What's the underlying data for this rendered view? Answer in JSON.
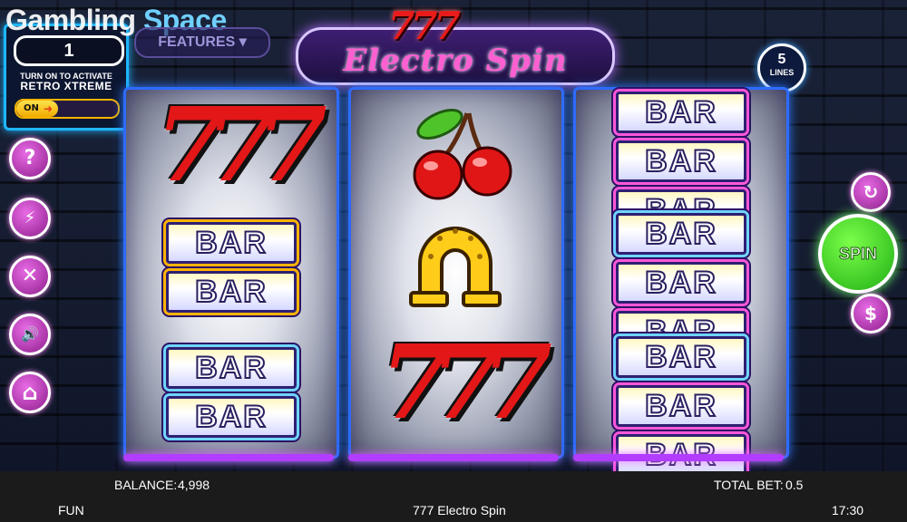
{
  "watermark": {
    "part1": "Gambling",
    "part2": "Space"
  },
  "bet_panel": {
    "bet_value": "1",
    "line1": "TURN ON TO ACTIVATE",
    "line2": "RETRO XTREME",
    "toggle_label": "ON"
  },
  "features_button": {
    "label": "FEATURES"
  },
  "logo": {
    "sevens": "777",
    "title": "Electro Spin"
  },
  "lines": {
    "count": "5",
    "label": "LINES"
  },
  "reels": [
    {
      "symbols": [
        "seven",
        "bar-double",
        "bar-double"
      ]
    },
    {
      "symbols": [
        "cherry",
        "horseshoe",
        "seven"
      ]
    },
    {
      "symbols": [
        "bar-triple",
        "bar-triple",
        "bar-triple"
      ]
    }
  ],
  "symbol_text": {
    "seven": "777",
    "bar": "BAR"
  },
  "side_buttons": [
    {
      "name": "help-icon",
      "glyph": "?"
    },
    {
      "name": "turbo-off-icon",
      "glyph": "⚡"
    },
    {
      "name": "settings-icon",
      "glyph": "✕"
    },
    {
      "name": "sound-icon",
      "glyph": "🔊"
    },
    {
      "name": "home-icon",
      "glyph": "⌂"
    }
  ],
  "right_buttons": {
    "autoplay_glyph": "↻",
    "spin_label": "SPIN",
    "bet_glyph": "$"
  },
  "status_bar": {
    "balance_label": "BALANCE:",
    "balance_value": "4,998",
    "total_bet_label": "TOTAL BET:",
    "total_bet_value": "0.5",
    "mode": "FUN",
    "game_name": "777 Electro Spin",
    "clock": "17:30"
  },
  "colors": {
    "reel_border": "#2e6bff",
    "spin_green": "#1fae14",
    "accent_pink": "#ff5fd1",
    "panel_cyan": "#1fb6ff"
  }
}
